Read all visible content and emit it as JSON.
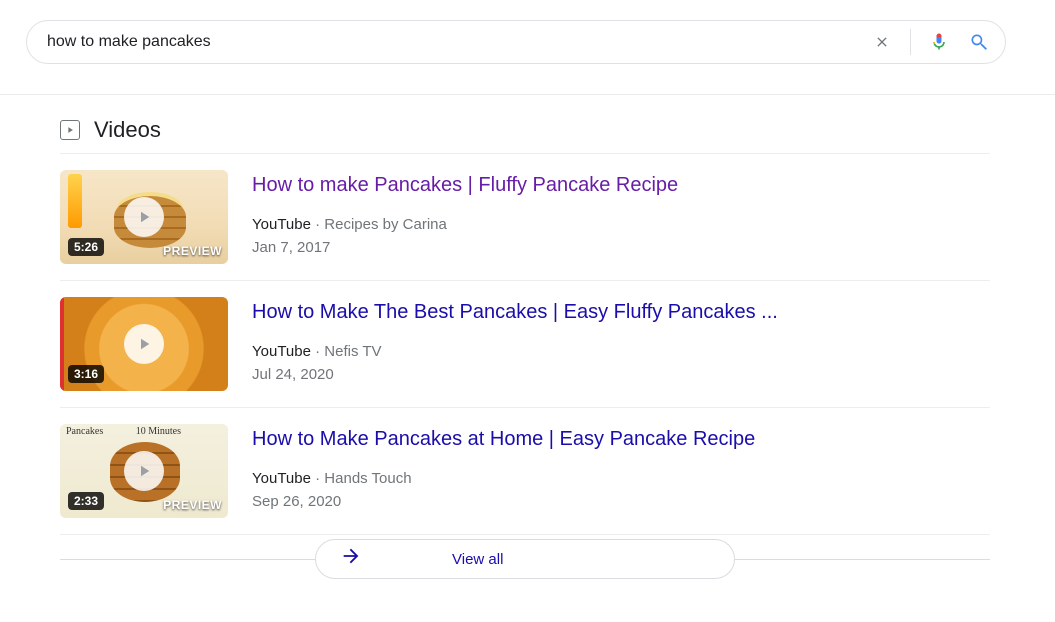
{
  "search": {
    "query": "how to make pancakes"
  },
  "section": {
    "title": "Videos",
    "view_all": "View all"
  },
  "videos": [
    {
      "title": "How to make Pancakes | Fluffy Pancake Recipe",
      "source": "YouTube",
      "channel": "Recipes by Carina",
      "date": "Jan 7, 2017",
      "duration": "5:26",
      "preview": "PREVIEW",
      "visited": true
    },
    {
      "title": "How to Make The Best Pancakes | Easy Fluffy Pancakes ...",
      "source": "YouTube",
      "channel": "Nefis TV",
      "date": "Jul 24, 2020",
      "duration": "3:16",
      "preview": "",
      "visited": false
    },
    {
      "title": "How to Make Pancakes at Home | Easy Pancake Recipe",
      "source": "YouTube",
      "channel": "Hands Touch",
      "date": "Sep 26, 2020",
      "duration": "2:33",
      "preview": "PREVIEW",
      "visited": false
    }
  ]
}
